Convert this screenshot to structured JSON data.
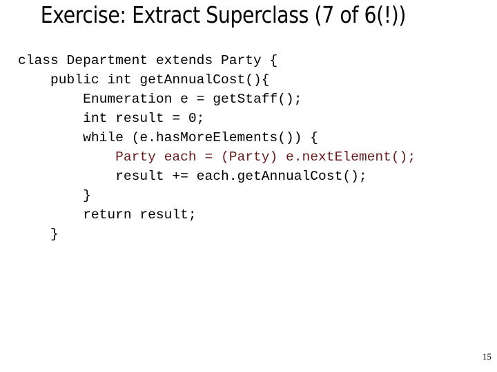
{
  "slide": {
    "title": "Exercise: Extract Superclass (7 of 6(!))",
    "page_number": "15"
  },
  "code": {
    "lines": [
      "class Department extends Party {",
      "    public int getAnnualCost(){",
      "        Enumeration e = getStaff();",
      "        int result = 0;",
      "        while (e.hasMoreElements()) {",
      "            Party each = (Party) e.nextElement();",
      "            result += each.getAnnualCost();",
      "        }",
      "        return result;",
      "    }"
    ],
    "highlight_color": "#6b1a1a"
  }
}
